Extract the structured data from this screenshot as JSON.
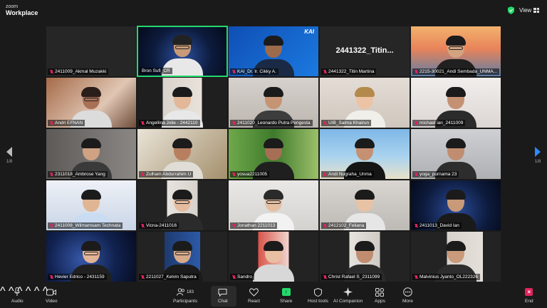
{
  "app": {
    "brand_small": "zoom",
    "brand_big": "Workplace"
  },
  "header": {
    "view_label": "View"
  },
  "pagination": {
    "left_page": "1/8",
    "right_page": "1/8"
  },
  "colors": {
    "accent_green": "#23d96b",
    "accent_blue": "#2d8cff",
    "mute_red": "#e0245e"
  },
  "tiles": [
    {
      "name": "2411009_Akmal Muzakki",
      "muted": true
    },
    {
      "name": "Bron Sufi_CR",
      "muted": false,
      "active": true
    },
    {
      "name": "KAI_Dr. Ir. Cikky A.",
      "muted": true,
      "logo": "KAI"
    },
    {
      "name": "2441322_Titin Martina",
      "muted": true,
      "big_name": "2441322_Titin..."
    },
    {
      "name": "2215-30021_Andi Sembada_UNMA...",
      "muted": true
    },
    {
      "name": "Andri EFNAN",
      "muted": true
    },
    {
      "name": "Angellina Jolie - 2442110",
      "muted": true
    },
    {
      "name": "2411020_Leonardo Putra Pengesta",
      "muted": true
    },
    {
      "name": "UIB_Salma Khairun",
      "muted": true
    },
    {
      "name": "michael ian_2411009",
      "muted": true
    },
    {
      "name": "2311018_Ambrose Yang",
      "muted": true
    },
    {
      "name": "Zulham Abdurrahim U",
      "muted": true
    },
    {
      "name": "yosua2211005",
      "muted": true
    },
    {
      "name": "Andi Nugraha_Unma",
      "muted": true
    },
    {
      "name": "yoga_purnama 23",
      "muted": true
    },
    {
      "name": "2411008_Wilmamsam Technata",
      "muted": true
    },
    {
      "name": "Vicna-2411016",
      "muted": true
    },
    {
      "name": "Jonathan 2211013",
      "muted": true
    },
    {
      "name": "2412102_Feliana",
      "muted": true
    },
    {
      "name": "2411013_David Ian",
      "muted": true
    },
    {
      "name": "Hevier Edrico - 2431159",
      "muted": true
    },
    {
      "name": "2211027_Kelvin Saputra",
      "muted": true
    },
    {
      "name": "Sandro",
      "muted": true
    },
    {
      "name": "Christ Rafael S_2311099",
      "muted": true
    },
    {
      "name": "Malvinius Jyanto_OL222326",
      "muted": true
    }
  ],
  "toolbar": {
    "audio": "Audio",
    "video": "Video",
    "participants": "Participants",
    "participants_count": "183",
    "chat": "Chat",
    "react": "React",
    "share": "Share",
    "host_tools": "Host tools",
    "ai_companion": "AI Companion",
    "apps": "Apps",
    "more": "More",
    "end": "End"
  }
}
